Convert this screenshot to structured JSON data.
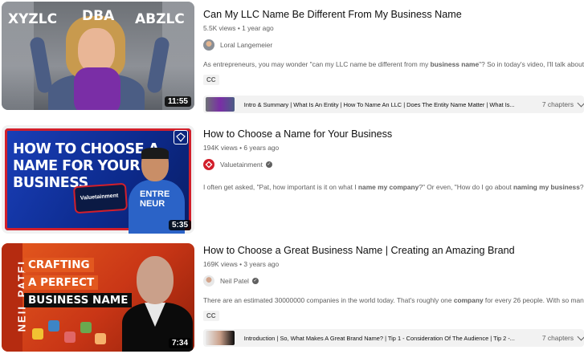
{
  "results": [
    {
      "title": "Can My LLC Name Be Different From My Business Name",
      "meta": "5.5K views • 1 year ago",
      "channel": "Loral Langemeier",
      "verified": false,
      "description_html": "As entrepreneurs, you may wonder \"can my LLC name be different from my business name\"? So in today's video, I'll talk about ...",
      "badge": "CC",
      "duration": "11:55",
      "thumb_words": [
        "XYZLC",
        "DBA",
        "ABZLC"
      ],
      "chapters_text": "Intro & Summary | What Is An Entity | How To Name An LLC | Does The Entity Name Matter | What Is...",
      "chapters_count": "7 chapters"
    },
    {
      "title": "How to Choose a Name for Your Business",
      "meta": "194K views • 6 years ago",
      "channel": "Valuetainment",
      "verified": true,
      "description_html": "I often get asked, \"Pat, how important is it on what I name my company?\" Or even, \"How do I go about naming my business?",
      "duration": "5:35",
      "thumb_text": "HOW TO CHOOSE A NAME FOR YOUR BUSINESS",
      "thumb_shirt": "ENTRE NEUR",
      "thumb_pillow": "Valuetainment"
    },
    {
      "title": "How to Choose a Great Business Name | Creating an Amazing Brand",
      "meta": "169K views • 3 years ago",
      "channel": "Neil Patel",
      "verified": true,
      "description_html": "There are an estimated 30000000 companies in the world today. That's roughly one company for every 26 people. With so many ...",
      "badge": "CC",
      "duration": "7:34",
      "thumb_side": "NEIL PATEL",
      "thumb_lines": [
        "CRAFTING",
        "A PERFECT",
        "BUSINESS NAME"
      ],
      "chapters_text": "Introduction | So, What Makes A Great Brand Name? | Tip 1 - Consideration Of The Audience | Tip 2 -...",
      "chapters_count": "7 chapters"
    }
  ],
  "colors": {
    "title": "#0f0f0f",
    "meta": "#606060",
    "chip_bg": "#f2f2f2",
    "valuetainment_red": "#d21f2b",
    "neil_orange": "#e2581f"
  }
}
